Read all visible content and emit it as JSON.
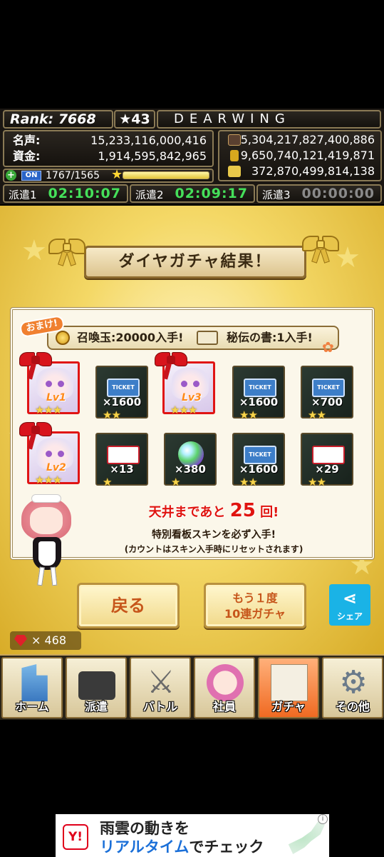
{
  "status": {
    "rank_label": "Rank: 7668",
    "star_level": "★43",
    "player_name": "DEARWING",
    "fame_label": "名声:",
    "fame_value": "15,233,116,000,416",
    "funds_label": "資金:",
    "funds_value": "1,914,595,842,965",
    "res1": "5,304,217,827,400,886",
    "res2": "9,650,740,121,419,871",
    "res3": "372,870,499,814,138",
    "on_badge": "ON",
    "xp_text": "1767/1565",
    "xp_fill_percent": 100,
    "dispatch": [
      {
        "label": "派遣1",
        "time": "02:10:07"
      },
      {
        "label": "派遣2",
        "time": "02:09:17"
      },
      {
        "label": "派遣3",
        "time": "00:00:00"
      }
    ]
  },
  "result": {
    "title": "ダイヤガチャ結果！",
    "bonus_tag": "おまけ!",
    "bonus_item1": "召喚玉:20000入手!",
    "bonus_item2": "秘伝の書:1入手!",
    "items": [
      {
        "kind": "character",
        "lv": "Lv1",
        "stars": "★★★"
      },
      {
        "kind": "ticket-blue",
        "qty": "×1600",
        "stars": "★★"
      },
      {
        "kind": "character",
        "lv": "Lv3",
        "stars": "★★★"
      },
      {
        "kind": "ticket-blue",
        "qty": "×1600",
        "stars": "★★"
      },
      {
        "kind": "ticket-blue",
        "qty": "×700",
        "stars": "★★"
      },
      {
        "kind": "character",
        "lv": "Lv2",
        "stars": "★★★"
      },
      {
        "kind": "ticket-red",
        "qty": "×13",
        "stars": "★"
      },
      {
        "kind": "orb",
        "qty": "×380",
        "stars": "★"
      },
      {
        "kind": "ticket-blue",
        "qty": "×1600",
        "stars": "★★"
      },
      {
        "kind": "ticket-red",
        "qty": "×29",
        "stars": "★★"
      }
    ],
    "ticket_text": "TICKET",
    "ceiling_pre": "天井まであと",
    "ceiling_num": "25",
    "ceiling_post": "回!",
    "ceiling_line2": "特別看板スキンを必ず入手!",
    "ceiling_line3": "(カウントはスキン入手時にリセットされます)"
  },
  "buttons": {
    "back": "戻る",
    "again_line1": "もう１度",
    "again_line2": "10連ガチャ",
    "share": "シェア"
  },
  "gems": "× 468",
  "nav": [
    {
      "label": "ホーム"
    },
    {
      "label": "派遣"
    },
    {
      "label": "バトル"
    },
    {
      "label": "社員"
    },
    {
      "label": "ガチャ"
    },
    {
      "label": "その他"
    }
  ],
  "ad": {
    "logo": "Y!",
    "line1": "雨雲の動きを",
    "line2_blue": "リアルタイム",
    "line2_black": "でチェック",
    "info": "i"
  },
  "colors": {
    "accent_gold": "#d8ac28",
    "timer_green": "#45e05a",
    "frame_red": "#e01414",
    "share_blue": "#1ab3e6"
  }
}
